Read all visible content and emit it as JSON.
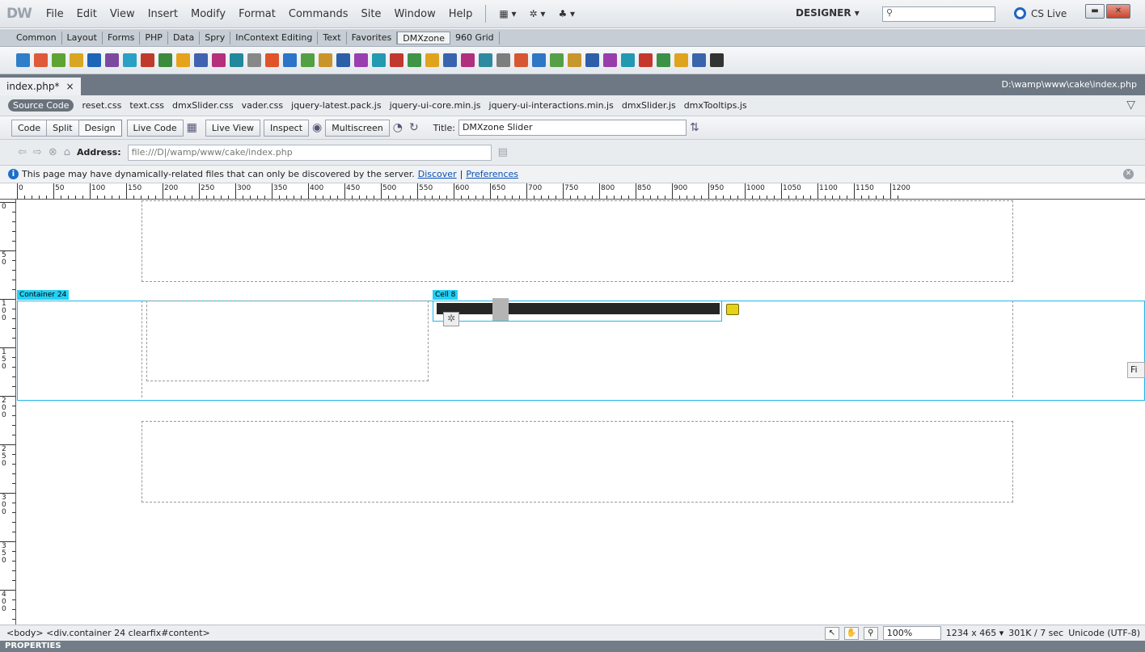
{
  "app": {
    "logo": "DW",
    "menu": [
      "File",
      "Edit",
      "View",
      "Insert",
      "Modify",
      "Format",
      "Commands",
      "Site",
      "Window",
      "Help"
    ],
    "workspace": "DESIGNER ▾",
    "search_placeholder": "",
    "cslive": "CS Live"
  },
  "insert_tabs": [
    "Common",
    "Layout",
    "Forms",
    "PHP",
    "Data",
    "Spry",
    "InContext Editing",
    "Text",
    "Favorites",
    "DMXzone",
    "960 Grid"
  ],
  "active_insert_tab": "DMXzone",
  "toolbar_colors": [
    "#2f7ec9",
    "#e05a3a",
    "#5fa332",
    "#d8a623",
    "#1c64b8",
    "#7b4aa0",
    "#2aa1c4",
    "#c03a2b",
    "#3b8a3e",
    "#e6a21a",
    "#4162b0",
    "#b62f7a",
    "#23889c",
    "#888888",
    "#e0542a",
    "#2b74c7",
    "#53a043",
    "#c9942b",
    "#2b5fa8",
    "#9a3fb0",
    "#229ab0",
    "#c1382f",
    "#3f9446",
    "#e0a41c",
    "#3964ad",
    "#b1307d",
    "#2d8aa0",
    "#7d7d7d",
    "#d85733",
    "#2d77c4",
    "#55a046",
    "#c7972d",
    "#2c5fa7",
    "#983eab",
    "#2399b1",
    "#c5372c",
    "#3c9148",
    "#dfa31e",
    "#3a65ab",
    "#333333"
  ],
  "document": {
    "tab": "index.php*",
    "close": "×",
    "path": "D:\\wamp\\www\\cake\\index.php"
  },
  "related_files": [
    "Source Code",
    "reset.css",
    "text.css",
    "dmxSlider.css",
    "vader.css",
    "jquery-latest.pack.js",
    "jquery-ui-core.min.js",
    "jquery-ui-interactions.min.js",
    "dmxSlider.js",
    "dmxTooltips.js"
  ],
  "doc_toolbar": {
    "code": "Code",
    "split": "Split",
    "design": "Design",
    "live_code": "Live Code",
    "live_view": "Live View",
    "inspect": "Inspect",
    "multiscreen": "Multiscreen",
    "title_label": "Title:",
    "title_value": "DMXzone Slider"
  },
  "nav": {
    "address_label": "Address:",
    "address_value": "file:///D|/wamp/www/cake/index.php"
  },
  "info": {
    "message": "This page may have dynamically-related files that can only be discovered by the server.",
    "discover": "Discover",
    "sep": "|",
    "preferences": "Preferences"
  },
  "ruler": {
    "h_labels": [
      "0",
      "50",
      "100",
      "150",
      "200",
      "250",
      "300",
      "350",
      "400",
      "450",
      "500",
      "550",
      "600",
      "650",
      "700",
      "750",
      "800",
      "850",
      "900",
      "950",
      "1000",
      "1050",
      "1100",
      "1150",
      "1200"
    ],
    "v_labels": [
      "0",
      "50",
      "100",
      "150",
      "200",
      "250",
      "300",
      "350",
      "400",
      "450"
    ]
  },
  "canvas": {
    "container_label": "Container 24",
    "cell_label": "Cell 8",
    "side_hint": "Fi",
    "slider_value_fraction": 0.18
  },
  "status": {
    "tags": "<body> <div.container  24 clearfix#content>",
    "zoom": "100%",
    "size": "1234 x 465 ▾",
    "download": "301K / 7 sec",
    "encoding": "Unicode (UTF-8)"
  },
  "properties_label": "PROPERTIES"
}
